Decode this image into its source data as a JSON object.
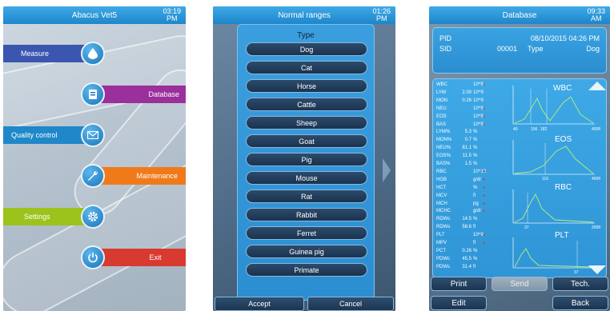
{
  "screen1": {
    "title": "Abacus Vet5",
    "clock": {
      "time": "03:19",
      "ampm": "PM"
    },
    "menu": [
      {
        "label": "Measure",
        "icon": "drop-icon",
        "color": "#3a56b0"
      },
      {
        "label": "Database",
        "icon": "database-icon",
        "color": "#9b2f9b"
      },
      {
        "label": "Quality control",
        "icon": "envelope-icon",
        "color": "#1f88c9"
      },
      {
        "label": "Maintenance",
        "icon": "wrench-icon",
        "color": "#f07a1a"
      },
      {
        "label": "Settings",
        "icon": "gear-icon",
        "color": "#9cc31c"
      },
      {
        "label": "Exit",
        "icon": "power-icon",
        "color": "#d93a2f"
      }
    ]
  },
  "screen2": {
    "title": "Normal ranges",
    "clock": {
      "time": "01:26",
      "ampm": "PM"
    },
    "type_title": "Type",
    "species": [
      "Dog",
      "Cat",
      "Horse",
      "Cattle",
      "Sheep",
      "Goat",
      "Pig",
      "Mouse",
      "Rat",
      "Rabbit",
      "Ferret",
      "Guinea pig",
      "Primate"
    ],
    "accept": "Accept",
    "cancel": "Cancel"
  },
  "screen3": {
    "title": "Database",
    "clock": {
      "time": "09:33",
      "ampm": "AM"
    },
    "pid_label": "PID",
    "pid_date": "08/10/2015 04:26 PM",
    "sid_label": "SID",
    "sid_value": "00001",
    "type_label": "Type",
    "type_value": "Dog",
    "params": [
      {
        "name": "WBC",
        "value": "",
        "unit": "10^9",
        "flag": true
      },
      {
        "name": "LYM",
        "value": "2.00",
        "unit": "10^9",
        "flag": false
      },
      {
        "name": "MON",
        "value": "0.26",
        "unit": "10^9",
        "flag": false
      },
      {
        "name": "NEU",
        "value": "",
        "unit": "10^9",
        "flag": true
      },
      {
        "name": "EOS",
        "value": "",
        "unit": "10^9",
        "flag": true
      },
      {
        "name": "BAS",
        "value": "",
        "unit": "10^9",
        "flag": true
      },
      {
        "name": "LYM%",
        "value": "5.3",
        "unit": "%",
        "flag": false
      },
      {
        "name": "MON%",
        "value": "0.7",
        "unit": "%",
        "flag": false
      },
      {
        "name": "NEU%",
        "value": "81.1",
        "unit": "%",
        "flag": false
      },
      {
        "name": "EOS%",
        "value": "11.5",
        "unit": "%",
        "flag": false
      },
      {
        "name": "BAS%",
        "value": "1.5",
        "unit": "%",
        "flag": false
      },
      {
        "name": "RBC",
        "value": "",
        "unit": "10^12",
        "flag": true
      },
      {
        "name": "HGB",
        "value": "",
        "unit": "g/dl",
        "flag": true
      },
      {
        "name": "HCT",
        "value": "",
        "unit": "%",
        "flag": true
      },
      {
        "name": "MCV",
        "value": "",
        "unit": "fl",
        "flag": true
      },
      {
        "name": "MCH",
        "value": "",
        "unit": "pg",
        "flag": true
      },
      {
        "name": "MCHC",
        "value": "",
        "unit": "g/dl",
        "flag": true
      },
      {
        "name": "RDWc",
        "value": "14.5",
        "unit": "%",
        "flag": false
      },
      {
        "name": "RDWs",
        "value": "58.6",
        "unit": "fl",
        "flag": false
      },
      {
        "name": "PLT",
        "value": "",
        "unit": "10^9",
        "flag": true
      },
      {
        "name": "MPV",
        "value": "",
        "unit": "fl",
        "flag": true
      },
      {
        "name": "PCT",
        "value": "0.26",
        "unit": "%",
        "flag": false
      },
      {
        "name": "PDWc",
        "value": "45.5",
        "unit": "%",
        "flag": false
      },
      {
        "name": "PDWs",
        "value": "31.4",
        "unit": "fl",
        "flag": false
      }
    ],
    "charts": [
      {
        "title": "WBC",
        "ticks": [
          "40",
          "156",
          "182",
          "400fl"
        ]
      },
      {
        "title": "EOS",
        "ticks": [
          "116",
          "400fl"
        ]
      },
      {
        "title": "RBC",
        "ticks": [
          "37",
          "200fl"
        ]
      },
      {
        "title": "PLT",
        "ticks": [
          "37"
        ]
      }
    ],
    "buttons": {
      "print": "Print",
      "send": "Send",
      "tech": "Tech.",
      "edit": "Edit",
      "back": "Back"
    }
  }
}
